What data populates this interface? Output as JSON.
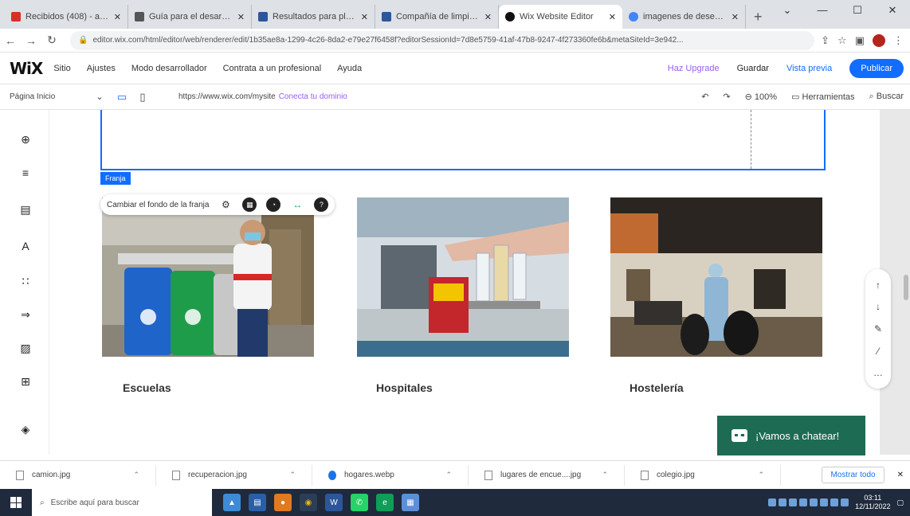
{
  "browser": {
    "tabs": [
      {
        "title": "Recibidos (408) - ale... ",
        "color": "#d93025",
        "active": false
      },
      {
        "title": "Guía para el desarroll... ",
        "color": "#444444",
        "active": false
      },
      {
        "title": "Resultados para plan... ",
        "color": "#2b579a",
        "active": false
      },
      {
        "title": "Compañía de limpiez... ",
        "color": "#2b579a",
        "active": false
      },
      {
        "title": "Wix Website Editor",
        "color": "#111111",
        "active": true
      },
      {
        "title": "imagenes de desech... ",
        "color": "#4285f4",
        "active": false
      }
    ],
    "new_tab": "+",
    "window_controls": [
      "⌄",
      "—",
      "☐",
      "✕"
    ],
    "url": "editor.wix.com/html/editor/web/renderer/edit/1b35ae8a-1299-4c26-8da2-e79e27f6458f?editorSessionId=7d8e5759-41af-47b8-9247-4f273360fe6b&metaSiteId=3e942..."
  },
  "wix_top": {
    "logo": "WiX",
    "menu": [
      "Sitio",
      "Ajustes",
      "Modo desarrollador",
      "Contrata a un profesional",
      "Ayuda"
    ],
    "upgrade": "Haz Upgrade",
    "save": "Guardar",
    "preview": "Vista previa",
    "publish": "Publicar"
  },
  "subbar": {
    "page": "Página Inicio",
    "site_url": "https://www.wix.com/mysite",
    "connect": "Conecta tu dominio",
    "zoom": "100%",
    "tools": "Herramientas",
    "search": "Buscar"
  },
  "canvas": {
    "strip_label": "Franja",
    "strip_toolbar_label": "Cambiar el fondo de la franja",
    "cards": [
      {
        "caption": "Escuelas"
      },
      {
        "caption": "Hospitales"
      },
      {
        "caption": "Hostelería"
      }
    ]
  },
  "chat": {
    "label": "¡Vamos a chatear!"
  },
  "downloads": {
    "items": [
      "camion.jpg",
      "recuperacion.jpg",
      "hogares.webp",
      "lugares de encue....jpg",
      "colegio.jpg"
    ],
    "show_all": "Mostrar todo"
  },
  "taskbar": {
    "search_placeholder": "Escribe aquí para buscar",
    "time": "03:11",
    "date": "12/11/2022"
  },
  "colors": {
    "accent": "#116dff",
    "upgrade": "#9a5cf5",
    "chat": "#1d6b53"
  }
}
